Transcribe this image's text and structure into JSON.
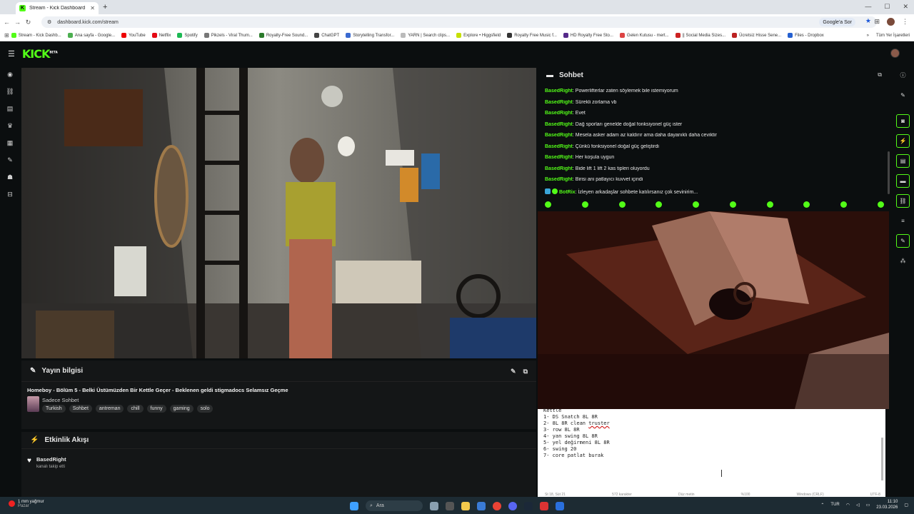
{
  "browser": {
    "tab_title": "Stream - Kick Dashboard",
    "tab_icon": "K",
    "new_tab": "+",
    "url": "dashboard.kick.com/stream",
    "google_button": "Google'a Sor",
    "bookmarks": [
      {
        "label": "Stream - Kick Dashb...",
        "color": "#53fc18"
      },
      {
        "label": "Ana sayfa - Google...",
        "color": "#4caf50"
      },
      {
        "label": "YouTube",
        "color": "#e00"
      },
      {
        "label": "Netflix",
        "color": "#e50914"
      },
      {
        "label": "Spotify",
        "color": "#1db954"
      },
      {
        "label": "Pikzels - Viral Thum...",
        "color": "#777"
      },
      {
        "label": "Royalty-Free Sound...",
        "color": "#2a7a2a"
      },
      {
        "label": "ChatGPT",
        "color": "#444"
      },
      {
        "label": "Storytelling Transfor...",
        "color": "#3a6ad0"
      },
      {
        "label": "YARN | Search clips...",
        "color": "#bbb"
      },
      {
        "label": "Explore • Higgsfield",
        "color": "#c6e000"
      },
      {
        "label": "Royalty Free Music f...",
        "color": "#333"
      },
      {
        "label": "HD Royalty Free Sto...",
        "color": "#552a8a"
      },
      {
        "label": "Gelen Kutusu - mert...",
        "color": "#d44"
      },
      {
        "label": "|| Social Media Sizes...",
        "color": "#c22"
      },
      {
        "label": "Ücretsiz Hisse Sene...",
        "color": "#b22"
      },
      {
        "label": "Files - Dropbox",
        "color": "#2560d0"
      }
    ],
    "all_bookmarks": "Tüm Yer İşaretleri"
  },
  "kick": {
    "logo": "KICK",
    "logo_badge": "BETA"
  },
  "stream_info": {
    "header": "Yayın bilgisi",
    "title": "Homeboy - Bölüm 5 - Belki Üstümüzden Bir Kettle Geçer - Beklenen geldi stigmadocs Selamsız Geçme",
    "category": "Sadece Sohbet",
    "tags": [
      "Turkish",
      "Sohbet",
      "antreman",
      "chill",
      "funny",
      "gaming",
      "solo"
    ]
  },
  "activity": {
    "header": "Etkinlik Akışı",
    "events": [
      {
        "user": "BasedRight",
        "action": "kanalı takip etti"
      }
    ]
  },
  "chat": {
    "header": "Sohbet",
    "messages": [
      {
        "user": "BasedRight",
        "text": ": Powerlifterlar zaten söylemek bile istemiyorum"
      },
      {
        "user": "BasedRight",
        "text": ": Sürekli zorlama vb"
      },
      {
        "user": "BasedRight",
        "text": ": Evet"
      },
      {
        "user": "BasedRight",
        "text": ": Dağ sporları genelde doğal fonksiyonel güç ister"
      },
      {
        "user": "BasedRight",
        "text": ": Mesela asker adam az kaldırır ama daha dayanıklı daha ceviktir"
      },
      {
        "user": "BasedRight",
        "text": ": Çünkü fonksiyonel doğal güç geliştirdi"
      },
      {
        "user": "BasedRight",
        "text": ": Her koşula uygun"
      },
      {
        "user": "BasedRight",
        "text": ": Bide lift 1 lift 2 kas tipleri oluyordu"
      },
      {
        "user": "BasedRight",
        "text": ": Birisi ani patlayıcı kuvvet içindi"
      }
    ],
    "bot_message": {
      "user": "BotRix",
      "text": ": İzleyen arkadaşlar sohbete katılırsanız çok sevinirim..."
    }
  },
  "notepad": {
    "lines": [
      "Kettle",
      "1- DS Snatch 8L 8R",
      "2- 8L 8R clean ",
      "3- row 8L 8R",
      "4- yan swing 8L 8R",
      "5- yel değirmeni 8L 8R",
      "6- swing 20",
      "7- core patlat burak"
    ],
    "misspelled": "truster",
    "status": [
      "St 18, Süt 21",
      "572 karakter",
      "Düz metin",
      "%100",
      "Windows (CRLF)",
      "UTF-8"
    ]
  },
  "taskbar": {
    "weather_temp": "1 mm yağmur",
    "weather_sub": "Pazar",
    "search": "Ara",
    "lang": "TUR",
    "time": "11:10",
    "date": "23.03.2026"
  },
  "colors": {
    "accent": "#53fc18",
    "bg": "#0b0e0f",
    "panel": "#141617"
  }
}
